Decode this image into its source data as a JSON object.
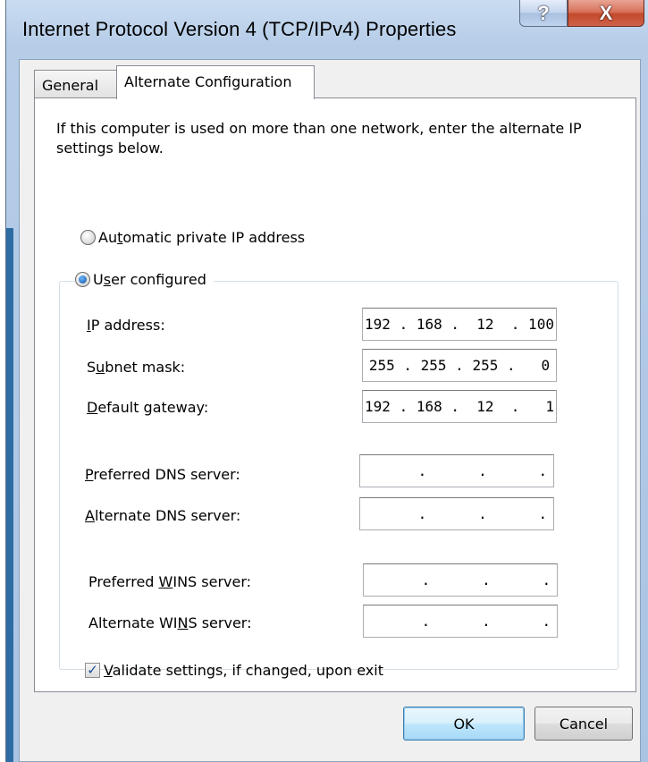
{
  "window": {
    "title": "Internet Protocol Version 4 (TCP/IPv4) Properties",
    "help_glyph": "?",
    "close_glyph": "X"
  },
  "tabs": [
    {
      "label": "General",
      "selected": false
    },
    {
      "label": "Alternate Configuration",
      "selected": true
    }
  ],
  "description": "If this computer is used on more than one network, enter the alternate IP settings below.",
  "options": {
    "automatic": {
      "pre": "Au",
      "accel": "t",
      "post": "omatic private IP address",
      "checked": false
    },
    "user": {
      "pre": "U",
      "accel": "s",
      "post": "er configured",
      "checked": true
    }
  },
  "fields": {
    "ip_address": {
      "pre": "",
      "accel": "I",
      "post": "P address:",
      "value": "192 . 168 .  12  . 100"
    },
    "subnet_mask": {
      "pre": "S",
      "accel": "u",
      "post": "bnet mask:",
      "value": "255 . 255 . 255 .   0"
    },
    "default_gateway": {
      "pre": "",
      "accel": "D",
      "post": "efault gateway:",
      "value": "192 . 168 .  12  .   1"
    },
    "preferred_dns": {
      "pre": "",
      "accel": "P",
      "post": "referred DNS server:",
      "value": "      .      .      ."
    },
    "alternate_dns": {
      "pre": "",
      "accel": "A",
      "post": "lternate DNS server:",
      "value": "      .      .      ."
    },
    "preferred_wins": {
      "pre": "Preferred ",
      "accel": "W",
      "post": "INS server:",
      "value": "      .      .      ."
    },
    "alternate_wins": {
      "pre": "Alternate WI",
      "accel": "N",
      "post": "S server:",
      "value": "      .      .      ."
    }
  },
  "validate": {
    "pre": "",
    "accel": "V",
    "post": "alidate settings, if changed, upon exit",
    "checked": true
  },
  "buttons": {
    "ok": "OK",
    "cancel": "Cancel"
  },
  "colors": {
    "title_bar": "#b6cde8",
    "close_button": "#c24a2c",
    "accent": "#2e6da4"
  }
}
